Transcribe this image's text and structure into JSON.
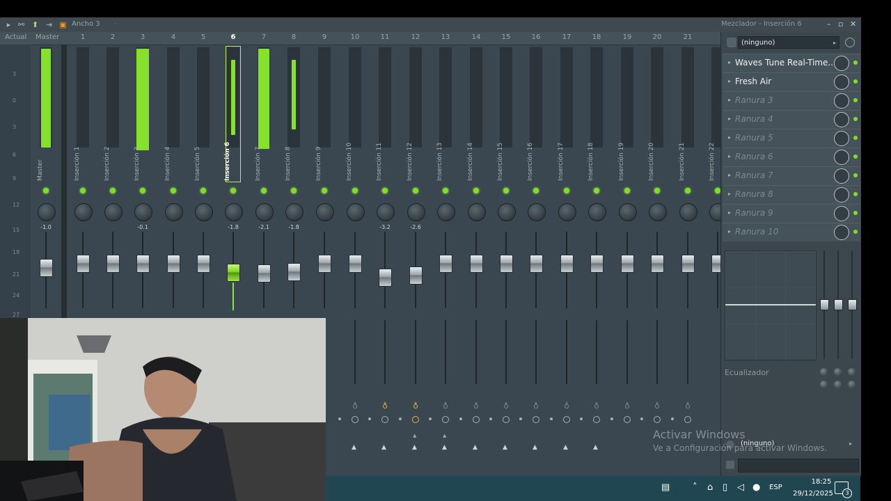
{
  "titlebar": {
    "tool_text": "Ancho 3",
    "title": "Mezclador - Inserción 6"
  },
  "header": [
    "Actual",
    "Master",
    "1",
    "2",
    "3",
    "4",
    "5",
    "6",
    "7",
    "8",
    "9",
    "10",
    "11",
    "12",
    "13",
    "14",
    "15",
    "16",
    "17",
    "18",
    "19",
    "20",
    "21"
  ],
  "scale": [
    "3",
    "0",
    "3",
    "6",
    "9",
    "12",
    "15",
    "18",
    "21",
    "24",
    "27"
  ],
  "strips": [
    {
      "label": "Master",
      "pan": "-1.0"
    },
    {
      "label": "Inserción 1",
      "pan": ""
    },
    {
      "label": "Inserción 2",
      "pan": ""
    },
    {
      "label": "Inserción 3",
      "pan": "-0.1"
    },
    {
      "label": "Inserción 4",
      "pan": ""
    },
    {
      "label": "Inserción 5",
      "pan": ""
    },
    {
      "label": "Inserción 6",
      "pan": "-1.8",
      "selected": true
    },
    {
      "label": "Inserción 7",
      "pan": "-2.1"
    },
    {
      "label": "Inserción 8",
      "pan": "-1.8"
    },
    {
      "label": "Inserción 9",
      "pan": ""
    },
    {
      "label": "Inserción 10",
      "pan": ""
    },
    {
      "label": "Inserción 11",
      "pan": "-3.2"
    },
    {
      "label": "Inserción 12",
      "pan": "-2.6"
    },
    {
      "label": "Inserción 13",
      "pan": ""
    },
    {
      "label": "Inserción 14",
      "pan": ""
    },
    {
      "label": "Inserción 15",
      "pan": ""
    },
    {
      "label": "Inserción 16",
      "pan": ""
    },
    {
      "label": "Inserción 17",
      "pan": ""
    },
    {
      "label": "Inserción 18",
      "pan": ""
    },
    {
      "label": "Inserción 19",
      "pan": ""
    },
    {
      "label": "Inserción 20",
      "pan": ""
    },
    {
      "label": "Inserción 21",
      "pan": ""
    },
    {
      "label": "Inserción 22",
      "pan": ""
    }
  ],
  "panel": {
    "input_select": "(ninguno)",
    "slots": [
      {
        "name": "Waves Tune Real-Time..",
        "empty": false
      },
      {
        "name": "Fresh Air",
        "empty": false
      },
      {
        "name": "Ranura 3",
        "empty": true
      },
      {
        "name": "Ranura 4",
        "empty": true
      },
      {
        "name": "Ranura 5",
        "empty": true
      },
      {
        "name": "Ranura 6",
        "empty": true
      },
      {
        "name": "Ranura 7",
        "empty": true
      },
      {
        "name": "Ranura 8",
        "empty": true
      },
      {
        "name": "Ranura 9",
        "empty": true
      },
      {
        "name": "Ranura 10",
        "empty": true
      }
    ],
    "eq_label": "Ecualizador",
    "output_select": "(ninguno)"
  },
  "watermark": {
    "line1": "Activar Windows",
    "line2": "Ve a Configuración para activar Windows."
  },
  "taskbar": {
    "lang": "ESP",
    "time": "18:25",
    "date": "29/12/2025",
    "notif_count": "3"
  },
  "colors": {
    "accent_green": "#86e12a",
    "mixer_bg": "#3a4650",
    "taskbar": "#1f4651"
  }
}
